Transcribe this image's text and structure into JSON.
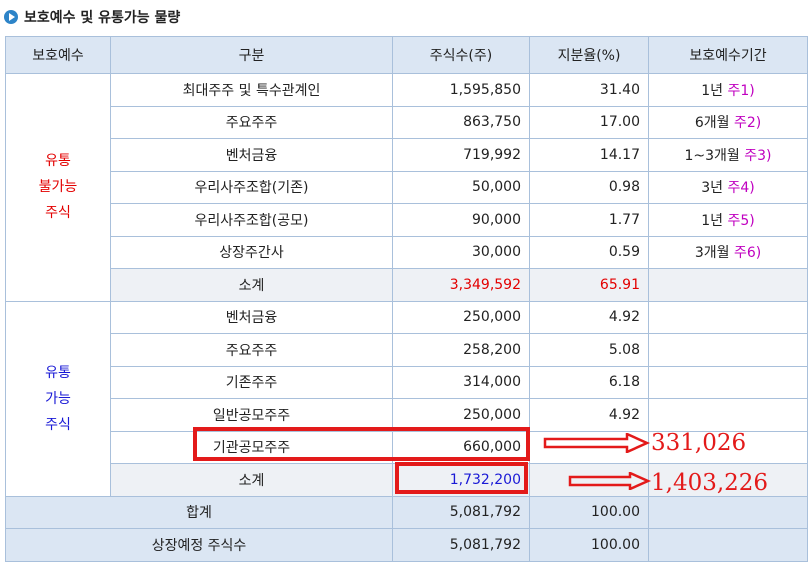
{
  "heading": {
    "title": "보호예수 및 유통가능 물량"
  },
  "table": {
    "headers": [
      "보호예수",
      "구분",
      "주식수(주)",
      "지분율(%)",
      "보호예수기간"
    ],
    "restricted": {
      "group_label": [
        "유통",
        "불가능",
        "주식"
      ],
      "rows": [
        {
          "category": "최대주주 및 특수관계인",
          "shares": "1,595,850",
          "ratio": "31.40",
          "period": "1년",
          "note": "주1)"
        },
        {
          "category": "주요주주",
          "shares": "863,750",
          "ratio": "17.00",
          "period": "6개월",
          "note": "주2)"
        },
        {
          "category": "벤처금융",
          "shares": "719,992",
          "ratio": "14.17",
          "period": "1~3개월",
          "note": "주3)"
        },
        {
          "category": "우리사주조합(기존)",
          "shares": "50,000",
          "ratio": "0.98",
          "period": "3년",
          "note": "주4)"
        },
        {
          "category": "우리사주조합(공모)",
          "shares": "90,000",
          "ratio": "1.77",
          "period": "1년",
          "note": "주5)"
        },
        {
          "category": "상장주간사",
          "shares": "30,000",
          "ratio": "0.59",
          "period": "3개월",
          "note": "주6)"
        }
      ],
      "subtotal": {
        "label": "소계",
        "shares": "3,349,592",
        "ratio": "65.91"
      }
    },
    "tradable": {
      "group_label": [
        "유통",
        "가능",
        "주식"
      ],
      "rows": [
        {
          "category": "벤처금융",
          "shares": "250,000",
          "ratio": "4.92"
        },
        {
          "category": "주요주주",
          "shares": "258,200",
          "ratio": "5.08"
        },
        {
          "category": "기존주주",
          "shares": "314,000",
          "ratio": "6.18"
        },
        {
          "category": "일반공모주주",
          "shares": "250,000",
          "ratio": "4.92"
        },
        {
          "category": "기관공모주주",
          "shares": "660,000",
          "ratio": ""
        }
      ],
      "subtotal": {
        "label": "소계",
        "shares": "1,732,200",
        "ratio": ""
      }
    },
    "total": {
      "label": "합계",
      "shares": "5,081,792",
      "ratio": "100.00"
    },
    "listed": {
      "label": "상장예정 주식수",
      "shares": "5,081,792",
      "ratio": "100.00"
    }
  },
  "annotations": {
    "institutional_adjusted": "331,026",
    "subtotal_adjusted": "1,403,226",
    "color": "#e31a1a"
  }
}
